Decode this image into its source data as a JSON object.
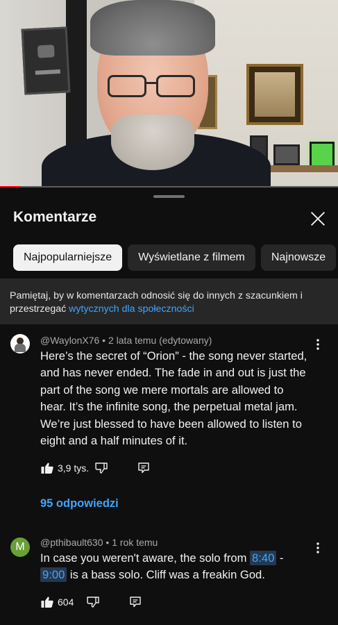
{
  "video": {
    "progress_fraction": 0.06
  },
  "sheet": {
    "title": "Komentarze",
    "close_icon": "close-icon"
  },
  "chips": [
    {
      "label": "Najpopularniejsze",
      "active": true
    },
    {
      "label": "Wyświetlane z filmem",
      "active": false
    },
    {
      "label": "Najnowsze",
      "active": false
    }
  ],
  "notice": {
    "text": "Pamiętaj, by w komentarzach odnosić się do innych z szacunkiem i przestrzegać ",
    "link": "wytycznych dla społeczności"
  },
  "comments": [
    {
      "avatar_icon": "user-avatar-icon",
      "author": "@WaylonX76",
      "meta": "2 lata temu (edytowany)",
      "text": "Here’s the secret of “Orion” - the song never started, and has never ended. The fade in and out is just the part of the song we mere mortals are allowed to hear. It’s the infinite song, the perpetual metal jam. We’re just blessed to have been allowed to listen to eight and a half minutes of it.",
      "likes": "3,9 tys.",
      "replies": "95 odpowiedzi"
    },
    {
      "avatar_letter": "M",
      "avatar_color": "#689f38",
      "author": "@pthibault630",
      "meta": "1 rok temu",
      "text_before": "In case you weren't aware, the solo from ",
      "timestamp_1": "8:40",
      "text_between": " - ",
      "timestamp_2": "9:00",
      "text_after": " is a bass solo. Cliff was a freakin God.",
      "likes": "604"
    }
  ],
  "colors": {
    "background": "#0f0f0f",
    "link": "#3ea6ff",
    "chip_active_bg": "#f1f1f1",
    "chip_bg": "#272727"
  }
}
